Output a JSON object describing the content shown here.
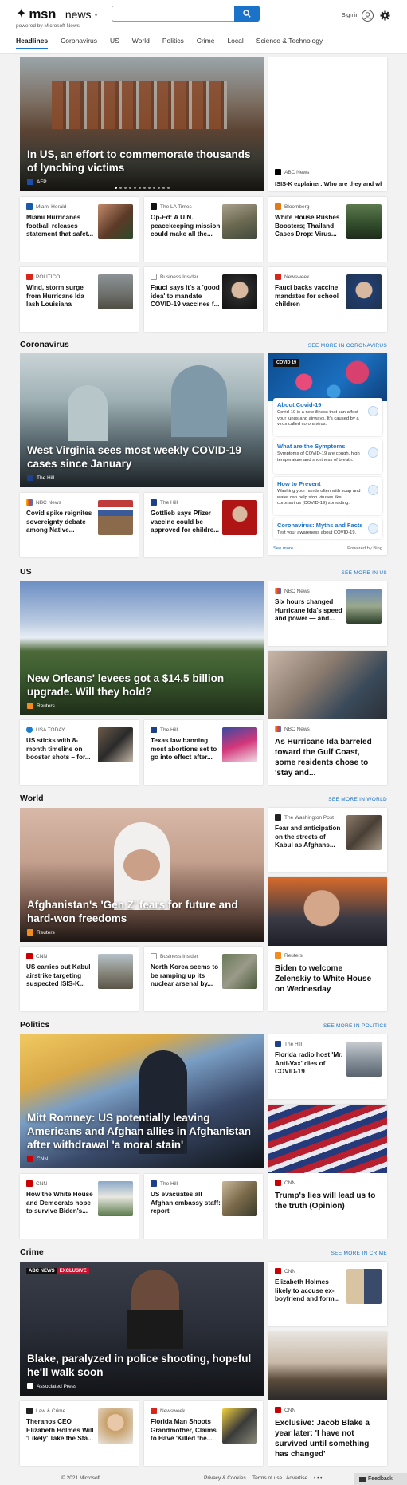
{
  "header": {
    "brand": "msn",
    "section": "news",
    "powered_by": "powered by Microsoft News",
    "search_placeholder": "",
    "sign_in": "Sign in"
  },
  "nav": [
    "Headlines",
    "Coronavirus",
    "US",
    "World",
    "Politics",
    "Crime",
    "Local",
    "Science & Technology"
  ],
  "headlines": {
    "hero": {
      "title": "In US, an effort to commemorate thousands of lynching victims",
      "source": "AFP"
    },
    "side_top": {
      "source": "ABC News",
      "title": "ISIS-K explainer: Who are they and what..."
    },
    "cards": [
      {
        "source": "Miami Herald",
        "title": "Miami Hurricanes football releases statement that safet..."
      },
      {
        "source": "The LA Times",
        "title": "Op-Ed: A U.N. peacekeeping mission could make all the..."
      },
      {
        "source": "Bloomberg",
        "title": "White House Rushes Boosters; Thailand Cases Drop: Virus..."
      },
      {
        "source": "POLITICO",
        "title": "Wind, storm surge from Hurricane Ida lash Louisiana"
      },
      {
        "source": "Business Insider",
        "title": "Fauci says it's a 'good idea' to mandate COVID-19 vaccines f..."
      },
      {
        "source": "Newsweek",
        "title": "Fauci backs vaccine mandates for school children"
      }
    ]
  },
  "coronavirus": {
    "heading": "Coronavirus",
    "see_more": "SEE MORE IN CORONAVIRUS",
    "hero": {
      "title": "West Virginia sees most weekly COVID-19 cases since January",
      "source": "The Hill"
    },
    "cards": [
      {
        "source": "NBC News",
        "title": "Covid spike reignites sovereignty debate among Native..."
      },
      {
        "source": "The Hill",
        "title": "Gottlieb says Pfizer vaccine could be approved for childre..."
      }
    ],
    "widget": {
      "tag": "COVID 19",
      "items": [
        {
          "title": "About Covid-19",
          "desc": "Covid-19 is a new illness that can affect your lungs and airways. It's caused by a virus called coronavirus."
        },
        {
          "title": "What are the Symptoms",
          "desc": "Symptoms of COVID-19 are cough, high temperature and shortness of breath."
        },
        {
          "title": "How to Prevent",
          "desc": "Washing your hands often with soap and water can help stop viruses like coronavirus (COVID-19) spreading."
        },
        {
          "title": "Coronavirus: Myths and Facts",
          "desc": "Test your awareness about COVID-19."
        }
      ],
      "see_more": "See more",
      "powered": "Powered by Bing"
    }
  },
  "us": {
    "heading": "US",
    "see_more": "SEE MORE IN US",
    "hero": {
      "title": "New Orleans' levees got a $14.5 billion upgrade. Will they hold?",
      "source": "Reuters"
    },
    "side_top": {
      "source": "NBC News",
      "title": "Six hours changed Hurricane Ida's speed and power — and..."
    },
    "cards": [
      {
        "source": "USA TODAY",
        "title": "US sticks with 8-month timeline on booster shots – for..."
      },
      {
        "source": "The Hill",
        "title": "Texas law banning most abortions set to go into effect after..."
      }
    ],
    "tall": {
      "source": "NBC News",
      "title": "As Hurricane Ida barreled toward the Gulf Coast, some residents chose to 'stay and..."
    }
  },
  "world": {
    "heading": "World",
    "see_more": "SEE MORE IN WORLD",
    "hero": {
      "title": "Afghanistan's 'Gen Z' fears for future and hard-won freedoms",
      "source": "Reuters"
    },
    "side_top": {
      "source": "The Washington Post",
      "title": "Fear and anticipation on the streets of Kabul as Afghans..."
    },
    "cards": [
      {
        "source": "CNN",
        "title": "US carries out Kabul airstrike targeting suspected ISIS-K..."
      },
      {
        "source": "Business Insider",
        "title": "North Korea seems to be ramping up its nuclear arsenal by..."
      }
    ],
    "tall": {
      "source": "Reuters",
      "title": "Biden to welcome Zelenskiy to White House on Wednesday"
    }
  },
  "politics": {
    "heading": "Politics",
    "see_more": "SEE MORE IN POLITICS",
    "hero": {
      "title": "Mitt Romney: US potentially leaving Americans and Afghan allies in Afghanistan after withdrawal 'a moral stain'",
      "source": "CNN"
    },
    "side_top": {
      "source": "The Hill",
      "title": "Florida radio host 'Mr. Anti-Vax' dies of COVID-19"
    },
    "cards": [
      {
        "source": "CNN",
        "title": "How the White House and Democrats hope to survive Biden's..."
      },
      {
        "source": "The Hill",
        "title": "US evacuates all Afghan embassy staff: report"
      }
    ],
    "tall": {
      "source": "CNN",
      "title": "Trump's lies will lead us to the truth (Opinion)"
    }
  },
  "crime": {
    "heading": "Crime",
    "see_more": "SEE MORE IN CRIME",
    "hero": {
      "title": "Blake, paralyzed in police shooting, hopeful he'll walk soon",
      "source": "Associated Press",
      "badge": "ABC NEWS EXCLUSIVE"
    },
    "side_top": {
      "source": "CNN",
      "title": "Elizabeth Holmes likely to accuse ex-boyfriend and form..."
    },
    "cards": [
      {
        "source": "Law & Crime",
        "title": "Theranos CEO Elizabeth Holmes Will 'Likely' Take the Sta..."
      },
      {
        "source": "Newsweek",
        "title": "Florida Man Shoots Grandmother, Claims to Have 'Killed the..."
      }
    ],
    "tall": {
      "source": "CNN",
      "title": "Exclusive: Jacob Blake a year later: 'I have not survived until something has changed'"
    }
  },
  "footer": {
    "copyright": "© 2021 Microsoft",
    "links": [
      "Privacy & Cookies",
      "Terms of use",
      "Advertise"
    ],
    "more": "• • •",
    "feedback": "Feedback"
  },
  "colors": {
    "accent": "#1a73c9",
    "background": "#f2f2f2"
  }
}
